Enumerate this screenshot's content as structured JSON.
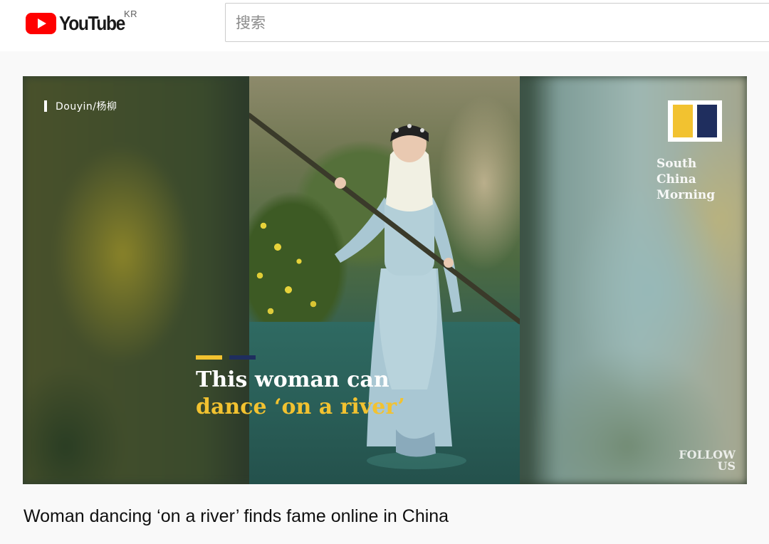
{
  "masthead": {
    "logo_text": "YouTube",
    "region": "KR",
    "search_placeholder": "搜索"
  },
  "video": {
    "source_credit": "Douyin/杨柳",
    "caption_line1": "This woman can",
    "caption_line2": "dance ‘on a river’",
    "brand_name_line1": "South China",
    "brand_name_line2": "Morning",
    "follow_line1": "FOLLOW",
    "follow_line2": "US",
    "title": "Woman dancing ‘on a river’ finds fame online in China"
  },
  "colors": {
    "youtube_red": "#ff0000",
    "brand_yellow": "#f2c230",
    "brand_navy": "#1f2e5e"
  },
  "icons": {
    "logo": "youtube-play-icon"
  }
}
